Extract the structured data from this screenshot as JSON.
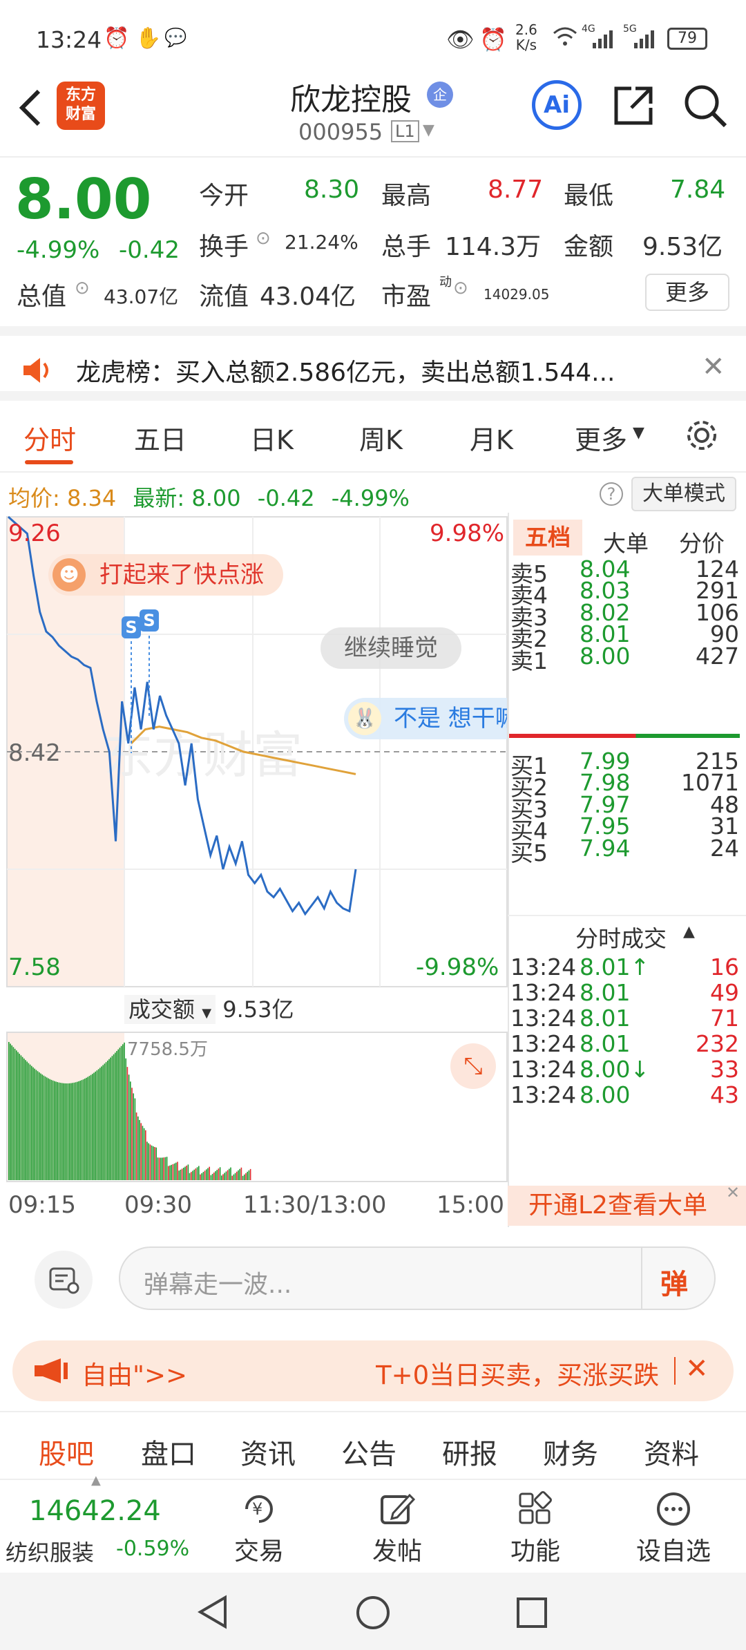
{
  "status": {
    "time": "13:24",
    "speed_value": "2.6",
    "speed_unit": "K/s",
    "net1": "4G",
    "net2": "5G",
    "battery": "79"
  },
  "header": {
    "logo_text": "东方\n财富",
    "stock_name": "欣龙控股",
    "badge": "企",
    "code": "000955",
    "level": "L1",
    "ai_label": "Ai"
  },
  "quote": {
    "price": "8.00",
    "change_pct": "-4.99%",
    "change_amt": "-0.42",
    "open_label": "今开",
    "open": "8.30",
    "high_label": "最高",
    "high": "8.77",
    "low_label": "最低",
    "low": "7.84",
    "turnover_label": "换手",
    "turnover": "21.24%",
    "volume_label": "总手",
    "volume": "114.3万",
    "amount_label": "金额",
    "amount": "9.53亿",
    "mcap_label": "总值",
    "mcap": "43.07亿",
    "float_label": "流值",
    "float_cap": "43.04亿",
    "pe_label": "市盈",
    "pe_sup": "动",
    "pe": "14029.05",
    "more_label": "更多"
  },
  "banner": {
    "text": "龙虎榜：买入总额2.586亿元，卖出总额1.544..."
  },
  "tabs": [
    "分时",
    "五日",
    "日K",
    "周K",
    "月K",
    "更多"
  ],
  "chart_info": {
    "avg_label": "均价:",
    "avg": "8.34",
    "latest_label": "最新:",
    "latest": "8.00",
    "chg": "-0.42",
    "pct": "-4.99%",
    "mode_label": "大单模式"
  },
  "chart_data": {
    "type": "line",
    "top_price": "9.26",
    "top_pct": "9.98%",
    "mid_price": "8.42",
    "bottom_price": "7.58",
    "bottom_pct": "-9.98%",
    "ylim": [
      7.58,
      9.26
    ],
    "prev_close": 8.42,
    "price": [
      9.26,
      9.24,
      9.22,
      9.2,
      9.05,
      8.92,
      8.85,
      8.83,
      8.8,
      8.78,
      8.76,
      8.75,
      8.73,
      8.72,
      8.6,
      8.5,
      8.42,
      8.1,
      8.6,
      8.45,
      8.65,
      8.5,
      8.67,
      8.5,
      8.62,
      8.55,
      8.5,
      8.45,
      8.3,
      8.45,
      8.25,
      8.15,
      8.05,
      8.12,
      8.0,
      8.08,
      8.02,
      8.1,
      7.98,
      7.95,
      7.98,
      7.92,
      7.9,
      7.93,
      7.89,
      7.85,
      7.88,
      7.84,
      7.87,
      7.9,
      7.86,
      7.92,
      7.88,
      7.86,
      7.85,
      8.0
    ],
    "avg": [
      8.45,
      8.5,
      8.51,
      8.5,
      8.49,
      8.47,
      8.46,
      8.44,
      8.42,
      8.41,
      8.4,
      8.39,
      8.38,
      8.37,
      8.36,
      8.35,
      8.34
    ],
    "volume_label": "成交额",
    "volume_total": "9.53亿",
    "volume_max_label": "7758.5万",
    "times": [
      "09:15",
      "09:30",
      "11:30/13:00",
      "15:00"
    ]
  },
  "chart_labels": {
    "bubble1": "打起来了快点涨",
    "bubble2": "继续睡觉",
    "bubble3": "不是 想干嘛",
    "s_mark": "S",
    "watermark": "东方财富"
  },
  "book": {
    "tabs": [
      "五档",
      "大单",
      "分价"
    ],
    "asks": [
      {
        "l": "卖5",
        "p": "8.04",
        "v": "124"
      },
      {
        "l": "卖4",
        "p": "8.03",
        "v": "291"
      },
      {
        "l": "卖3",
        "p": "8.02",
        "v": "106"
      },
      {
        "l": "卖2",
        "p": "8.01",
        "v": "90"
      },
      {
        "l": "卖1",
        "p": "8.00",
        "v": "427"
      }
    ],
    "bids": [
      {
        "l": "买1",
        "p": "7.99",
        "v": "215"
      },
      {
        "l": "买2",
        "p": "7.98",
        "v": "1071"
      },
      {
        "l": "买3",
        "p": "7.97",
        "v": "48"
      },
      {
        "l": "买4",
        "p": "7.95",
        "v": "31"
      },
      {
        "l": "买5",
        "p": "7.94",
        "v": "24"
      }
    ],
    "trades_title": "分时成交",
    "trades": [
      {
        "t": "13:24",
        "p": "8.01↑",
        "v": "16"
      },
      {
        "t": "13:24",
        "p": "8.01",
        "v": "49"
      },
      {
        "t": "13:24",
        "p": "8.01",
        "v": "71"
      },
      {
        "t": "13:24",
        "p": "8.01",
        "v": "232"
      },
      {
        "t": "13:24",
        "p": "8.00↓",
        "v": "33"
      },
      {
        "t": "13:24",
        "p": "8.00",
        "v": "43"
      }
    ],
    "l2_label": "开通L2查看大单"
  },
  "danmu": {
    "placeholder": "弹幕走一波...",
    "send": "弹"
  },
  "promo": {
    "left": "自由\">>",
    "right": "T+0当日买卖，买涨买跌"
  },
  "bottom_tabs": [
    "股吧",
    "盘口",
    "资讯",
    "公告",
    "研报",
    "财务",
    "资料"
  ],
  "bottom_bar": {
    "index_value": "14642.24",
    "index_name": "纺织服装",
    "index_pct": "-0.59%",
    "items": [
      "交易",
      "发帖",
      "功能",
      "设自选"
    ]
  }
}
